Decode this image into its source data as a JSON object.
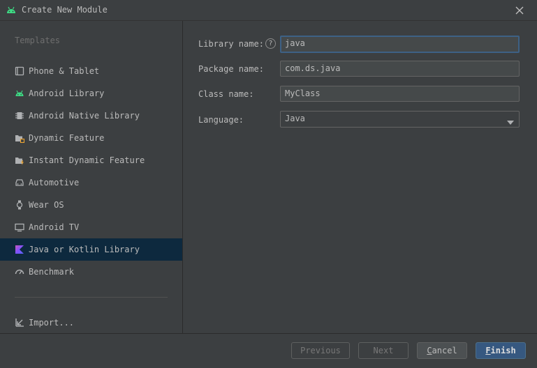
{
  "window": {
    "title": "Create New Module"
  },
  "sidebar": {
    "section_label": "Templates",
    "items": [
      {
        "label": "Phone & Tablet",
        "icon": "phone-tablet-icon"
      },
      {
        "label": "Android Library",
        "icon": "android-icon"
      },
      {
        "label": "Android Native Library",
        "icon": "chip-icon"
      },
      {
        "label": "Dynamic Feature",
        "icon": "folder-feature-icon"
      },
      {
        "label": "Instant Dynamic Feature",
        "icon": "folder-instant-icon"
      },
      {
        "label": "Automotive",
        "icon": "car-icon"
      },
      {
        "label": "Wear OS",
        "icon": "watch-icon"
      },
      {
        "label": "Android TV",
        "icon": "tv-icon"
      },
      {
        "label": "Java or Kotlin Library",
        "icon": "kotlin-icon",
        "selected": true
      },
      {
        "label": "Benchmark",
        "icon": "gauge-icon"
      }
    ],
    "import_label": "Import..."
  },
  "form": {
    "library_name": {
      "label": "Library name:",
      "value": "java"
    },
    "package_name": {
      "label": "Package name:",
      "value": "com.ds.java"
    },
    "class_name": {
      "label": "Class name:",
      "value": "MyClass"
    },
    "language": {
      "label": "Language:",
      "value": "Java"
    },
    "help_glyph": "?"
  },
  "footer": {
    "previous": "Previous",
    "next": "Next",
    "cancel_first": "C",
    "cancel_rest": "ancel",
    "finish_first": "F",
    "finish_rest": "inish"
  },
  "colors": {
    "accent": "#365880",
    "selection": "#0d293e",
    "background": "#3c3f41"
  }
}
